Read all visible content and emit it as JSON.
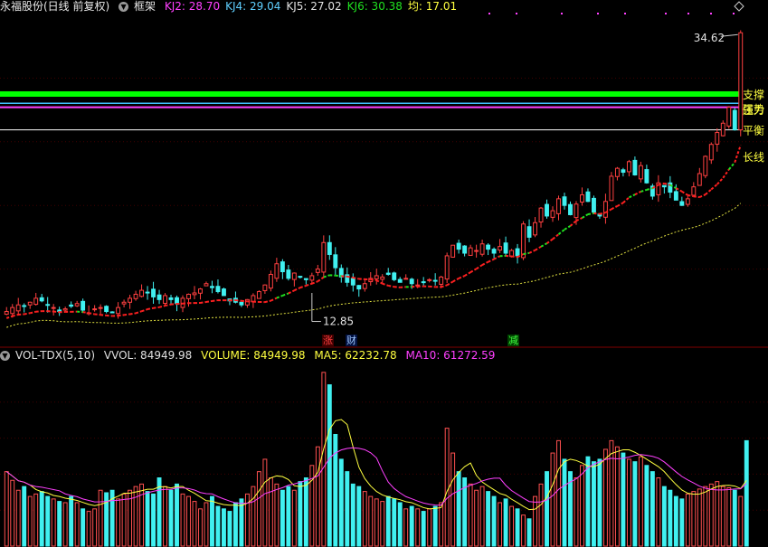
{
  "header": {
    "stock_name": "永福股份(日线 前复权)",
    "framework_label": "框架",
    "indicators": [
      {
        "label": "KJ2:",
        "value": "28.70",
        "color": "#ff40ff"
      },
      {
        "label": "KJ4:",
        "value": "29.04",
        "color": "#60d0ff"
      },
      {
        "label": "KJ5:",
        "value": "27.02",
        "color": "#e0e0e0"
      },
      {
        "label": "KJ6:",
        "value": "30.38",
        "color": "#20e020"
      },
      {
        "label": "均:",
        "value": "17.01",
        "color": "#ffff40"
      }
    ]
  },
  "level_lines": [
    {
      "name": "支撑",
      "color": "#00ff00"
    },
    {
      "name": "强势",
      "color": "#ff40ff"
    },
    {
      "name": "压力",
      "color": "#40c0ff"
    },
    {
      "name": "平衡",
      "color": "#ffffff"
    },
    {
      "name": "长线",
      "color": "#ff3030"
    }
  ],
  "markers": {
    "high_label": "34.62",
    "low_label": "12.85",
    "event_tags": [
      {
        "text": "涨",
        "color": "#ff4040",
        "bg": "#400000"
      },
      {
        "text": "财",
        "color": "#a0c8ff",
        "bg": "#001040"
      },
      {
        "text": "减",
        "color": "#40ff40",
        "bg": "#004000"
      }
    ]
  },
  "volume_panel": {
    "title": "VOL-TDX(5,10)",
    "vvol": "VVOL: 84949.98",
    "volume": "VOLUME: 84949.98",
    "ma5": "MA5: 62232.78",
    "ma10": "MA10: 61272.59",
    "colors": {
      "up": "#ff5050",
      "down": "#40f0f0",
      "ma5": "#ffff40",
      "ma10": "#ff40ff"
    }
  },
  "chart_data": [
    {
      "type": "candlestick",
      "series_summary": "daily price candles with 长线 support line",
      "y_range": [
        12.0,
        36.0
      ],
      "levels": {
        "支撑": 30.0,
        "强势": 29.0,
        "压力": 29.3,
        "平衡": 27.3,
        "长线": 26.3
      },
      "high": 34.62,
      "low": 12.85,
      "closes": [
        13.6,
        13.9,
        14.1,
        14.0,
        14.3,
        14.6,
        14.4,
        14.1,
        13.9,
        13.6,
        13.8,
        14.0,
        14.2,
        13.7,
        13.5,
        13.8,
        13.9,
        13.6,
        13.5,
        13.9,
        14.3,
        14.6,
        14.9,
        15.2,
        15.0,
        14.7,
        14.5,
        14.8,
        14.5,
        14.2,
        14.6,
        14.9,
        15.0,
        15.3,
        15.7,
        15.4,
        15.1,
        14.8,
        14.4,
        14.3,
        14.1,
        14.5,
        14.8,
        15.1,
        15.6,
        16.4,
        17.2,
        16.6,
        16.1,
        16.5,
        16.2,
        16.0,
        16.3,
        16.8,
        18.8,
        17.9,
        16.9,
        16.2,
        15.8,
        15.6,
        15.3,
        15.7,
        16.1,
        16.3,
        16.2,
        16.4,
        16.0,
        15.8,
        16.1,
        15.7,
        15.6,
        15.8,
        16.0,
        15.9,
        16.2,
        17.8,
        18.6,
        18.3,
        18.0,
        18.4,
        18.2,
        18.7,
        18.3,
        18.0,
        18.5,
        18.0,
        18.2,
        17.8,
        20.2,
        19.2,
        20.3,
        21.4,
        20.8,
        21.2,
        22.1,
        21.6,
        20.9,
        21.7,
        22.4,
        21.9,
        21.1,
        20.8,
        21.9,
        23.8,
        24.4,
        24.1,
        24.9,
        23.9,
        24.6,
        23.3,
        22.3,
        23.3,
        23.0,
        22.6,
        22.0,
        21.6,
        22.1,
        23.0,
        24.0,
        25.3,
        26.2,
        27.1,
        27.8,
        29.0,
        27.3,
        34.62
      ],
      "volume_y_range": [
        0,
        145000
      ],
      "volumes": [
        60000,
        53000,
        45000,
        48000,
        40000,
        42000,
        44000,
        40000,
        38000,
        36000,
        35000,
        40000,
        35000,
        30000,
        28000,
        30000,
        45000,
        43000,
        45000,
        38000,
        42000,
        45000,
        48000,
        50000,
        44000,
        42000,
        55000,
        48000,
        45000,
        50000,
        42000,
        40000,
        36000,
        30000,
        35000,
        40000,
        32000,
        30000,
        28000,
        35000,
        38000,
        42000,
        48000,
        60000,
        70000,
        55000,
        50000,
        45000,
        48000,
        45000,
        52000,
        55000,
        65000,
        80000,
        140000,
        130000,
        90000,
        70000,
        60000,
        50000,
        48000,
        44000,
        40000,
        38000,
        36000,
        40000,
        38000,
        35000,
        30000,
        32000,
        30000,
        28000,
        30000,
        32000,
        35000,
        95000,
        75000,
        60000,
        55000,
        50000,
        45000,
        48000,
        44000,
        40000,
        35000,
        38000,
        32000,
        30000,
        25000,
        22000,
        40000,
        50000,
        60000,
        75000,
        85000,
        70000,
        60000,
        55000,
        65000,
        72000,
        68000,
        70000,
        78000,
        85000,
        80000,
        75000,
        70000,
        68000,
        72000,
        65000,
        60000,
        55000,
        48000,
        45000,
        40000,
        38000,
        42000,
        44000,
        46000,
        48000,
        50000,
        52000,
        48000,
        47000,
        45000,
        40000,
        84949.98
      ]
    }
  ]
}
